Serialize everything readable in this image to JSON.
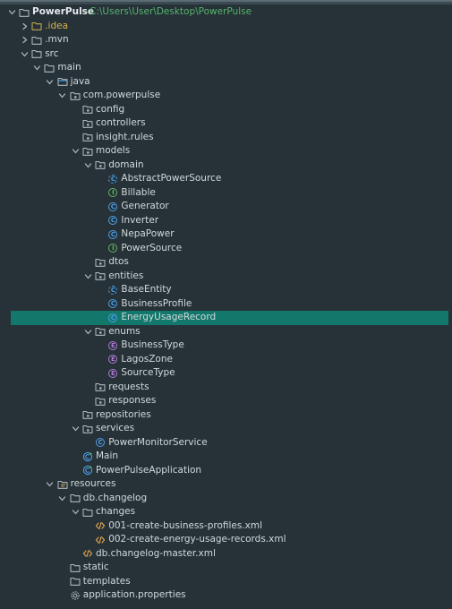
{
  "project": {
    "name": "PowerPulse",
    "path": "C:\\Users\\User\\Desktop\\PowerPulse"
  },
  "nodes": [
    {
      "label": "PowerPulse",
      "kind": "project",
      "depth": 0,
      "arrow": "down",
      "icon": "folder-icon"
    },
    {
      "label": ".idea",
      "kind": "idea",
      "depth": 1,
      "arrow": "right",
      "icon": "folder-icon"
    },
    {
      "label": ".mvn",
      "kind": "folder",
      "depth": 1,
      "arrow": "right",
      "icon": "folder-icon"
    },
    {
      "label": "src",
      "kind": "folder",
      "depth": 1,
      "arrow": "down",
      "icon": "folder-icon"
    },
    {
      "label": "main",
      "kind": "folder",
      "depth": 2,
      "arrow": "down",
      "icon": "folder-icon"
    },
    {
      "label": "java",
      "kind": "folder",
      "depth": 3,
      "arrow": "down",
      "icon": "source-folder-icon"
    },
    {
      "label": "com.powerpulse",
      "kind": "folder",
      "depth": 4,
      "arrow": "down",
      "icon": "package-icon"
    },
    {
      "label": "config",
      "kind": "folder",
      "depth": 5,
      "arrow": "",
      "icon": "package-icon"
    },
    {
      "label": "controllers",
      "kind": "folder",
      "depth": 5,
      "arrow": "",
      "icon": "package-icon"
    },
    {
      "label": "insight.rules",
      "kind": "folder",
      "depth": 5,
      "arrow": "",
      "icon": "package-icon"
    },
    {
      "label": "models",
      "kind": "folder",
      "depth": 5,
      "arrow": "down",
      "icon": "package-icon"
    },
    {
      "label": "domain",
      "kind": "folder",
      "depth": 6,
      "arrow": "down",
      "icon": "package-icon"
    },
    {
      "label": "AbstractPowerSource",
      "kind": "abstract",
      "depth": 7,
      "arrow": "",
      "icon": "abstract-class-icon"
    },
    {
      "label": "Billable",
      "kind": "interface",
      "depth": 7,
      "arrow": "",
      "icon": "interface-icon"
    },
    {
      "label": "Generator",
      "kind": "class",
      "depth": 7,
      "arrow": "",
      "icon": "class-icon"
    },
    {
      "label": "Inverter",
      "kind": "class",
      "depth": 7,
      "arrow": "",
      "icon": "class-icon"
    },
    {
      "label": "NepaPower",
      "kind": "class",
      "depth": 7,
      "arrow": "",
      "icon": "class-icon"
    },
    {
      "label": "PowerSource",
      "kind": "interface",
      "depth": 7,
      "arrow": "",
      "icon": "interface-icon"
    },
    {
      "label": "dtos",
      "kind": "folder",
      "depth": 6,
      "arrow": "",
      "icon": "package-icon"
    },
    {
      "label": "entities",
      "kind": "folder",
      "depth": 6,
      "arrow": "down",
      "icon": "package-icon"
    },
    {
      "label": "BaseEntity",
      "kind": "abstract",
      "depth": 7,
      "arrow": "",
      "icon": "abstract-class-icon"
    },
    {
      "label": "BusinessProfile",
      "kind": "class",
      "depth": 7,
      "arrow": "",
      "icon": "class-icon"
    },
    {
      "label": "EnergyUsageRecord",
      "kind": "class",
      "depth": 7,
      "arrow": "",
      "icon": "class-icon",
      "selected": true
    },
    {
      "label": "enums",
      "kind": "folder",
      "depth": 6,
      "arrow": "down",
      "icon": "package-icon"
    },
    {
      "label": "BusinessType",
      "kind": "enum",
      "depth": 7,
      "arrow": "",
      "icon": "enum-icon"
    },
    {
      "label": "LagosZone",
      "kind": "enum",
      "depth": 7,
      "arrow": "",
      "icon": "enum-icon"
    },
    {
      "label": "SourceType",
      "kind": "enum",
      "depth": 7,
      "arrow": "",
      "icon": "enum-icon"
    },
    {
      "label": "requests",
      "kind": "folder",
      "depth": 6,
      "arrow": "",
      "icon": "package-icon"
    },
    {
      "label": "responses",
      "kind": "folder",
      "depth": 6,
      "arrow": "",
      "icon": "package-icon"
    },
    {
      "label": "repositories",
      "kind": "folder",
      "depth": 5,
      "arrow": "",
      "icon": "package-icon"
    },
    {
      "label": "services",
      "kind": "folder",
      "depth": 5,
      "arrow": "down",
      "icon": "package-icon"
    },
    {
      "label": "PowerMonitorService",
      "kind": "class",
      "depth": 6,
      "arrow": "",
      "icon": "class-icon"
    },
    {
      "label": "Main",
      "kind": "runnable",
      "depth": 5,
      "arrow": "",
      "icon": "runnable-class-icon"
    },
    {
      "label": "PowerPulseApplication",
      "kind": "runnable",
      "depth": 5,
      "arrow": "",
      "icon": "runnable-class-icon"
    },
    {
      "label": "resources",
      "kind": "folder",
      "depth": 3,
      "arrow": "down",
      "icon": "resources-folder-icon"
    },
    {
      "label": "db.changelog",
      "kind": "folder",
      "depth": 4,
      "arrow": "down",
      "icon": "folder-icon"
    },
    {
      "label": "changes",
      "kind": "folder",
      "depth": 5,
      "arrow": "down",
      "icon": "folder-icon"
    },
    {
      "label": "001-create-business-profiles.xml",
      "kind": "xml",
      "depth": 6,
      "arrow": "",
      "icon": "xml-icon"
    },
    {
      "label": "002-create-energy-usage-records.xml",
      "kind": "xml",
      "depth": 6,
      "arrow": "",
      "icon": "xml-icon"
    },
    {
      "label": "db.changelog-master.xml",
      "kind": "xml",
      "depth": 5,
      "arrow": "",
      "icon": "xml-icon"
    },
    {
      "label": "static",
      "kind": "folder",
      "depth": 4,
      "arrow": "",
      "icon": "folder-icon"
    },
    {
      "label": "templates",
      "kind": "folder",
      "depth": 4,
      "arrow": "",
      "icon": "folder-icon"
    },
    {
      "label": "application.properties",
      "kind": "properties",
      "depth": 4,
      "arrow": "",
      "icon": "gear-icon"
    }
  ],
  "colors": {
    "background": "#263238",
    "selection": "#13786c",
    "path": "#57b36c",
    "idea": "#d7b34a",
    "class": "#4c9ee6",
    "interface": "#5fb85f",
    "enum": "#b07ad6",
    "xml": "#e6a64a"
  }
}
